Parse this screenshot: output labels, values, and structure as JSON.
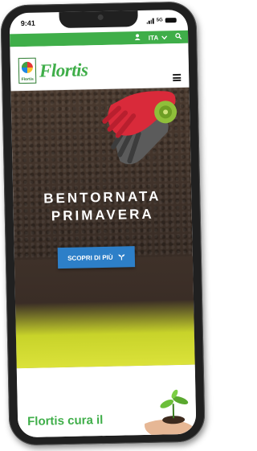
{
  "status": {
    "time": "9:41",
    "network": "5G"
  },
  "topbar": {
    "language": "ITA"
  },
  "header": {
    "brand": "Flortis",
    "badge_text": "Flortis"
  },
  "hero": {
    "title_line1": "BENTORNATA",
    "title_line2": "PRIMAVERA",
    "cta_label": "SCOPRI DI PIÙ"
  },
  "section": {
    "title": "Flortis cura il"
  },
  "colors": {
    "brand_green": "#3fae49",
    "cta_blue": "#2d7fc8",
    "accent_yellow": "#dbe23a",
    "soil_brown": "#3d3028"
  }
}
